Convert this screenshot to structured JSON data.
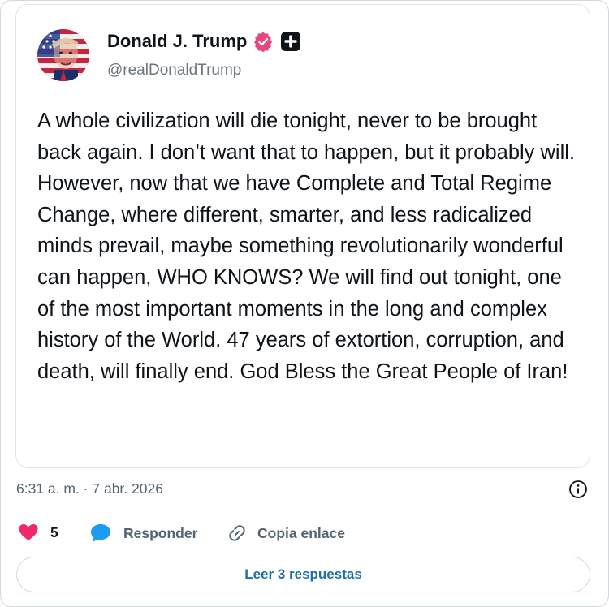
{
  "post": {
    "author_name": "Donald J. Trump",
    "handle": "@realDonaldTrump",
    "text": "A whole civilization will die tonight, never to be brought back again. I don’t want that to happen, but it probably will. However, now that we have Complete and Total Regime Change, where different, smarter, and less radicalized minds prevail, maybe something revolutionarily wonderful can happen, WHO KNOWS? We will find out tonight, one of the most important moments in the long and complex history of the World. 47 years of extortion, corruption, and death, will finally end. God Bless the Great People of Iran!"
  },
  "meta": {
    "timestamp": "6:31 a. m. · 7 abr. 2026"
  },
  "actions": {
    "like_count": "5",
    "reply_label": "Responder",
    "copy_link_label": "Copia enlace"
  },
  "footer": {
    "read_replies_label": "Leer 3 respuestas"
  },
  "icons": {
    "verified": "verified-badge-icon",
    "plus": "plus-square-icon",
    "info": "info-circle-icon",
    "like": "heart-icon",
    "reply": "speech-bubble-icon",
    "link": "link-icon"
  },
  "colors": {
    "verified_badge": "#e8467c",
    "heart": "#f0286c",
    "reply_bubble": "#1d9bf0",
    "link_text": "#1d6fa5",
    "muted_text": "#536471"
  }
}
